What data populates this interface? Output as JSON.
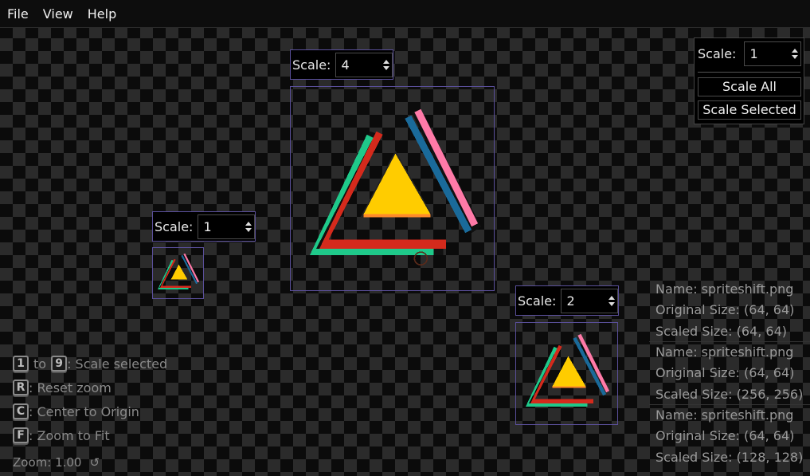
{
  "menu": {
    "items": [
      "File",
      "View",
      "Help"
    ]
  },
  "sprites": [
    {
      "scale_label": "Scale:",
      "scale_value": "4"
    },
    {
      "scale_label": "Scale:",
      "scale_value": "1"
    },
    {
      "scale_label": "Scale:",
      "scale_value": "2"
    }
  ],
  "panel": {
    "scale_label": "Scale:",
    "scale_value": "1",
    "scale_all": "Scale All",
    "scale_selected": "Scale Selected"
  },
  "info": [
    {
      "name": "Name: spriteshift.png",
      "original": "Original Size: (64, 64)",
      "scaled": "Scaled Size: (64, 64)"
    },
    {
      "name": "Name: spriteshift.png",
      "original": "Original Size: (64, 64)",
      "scaled": "Scaled Size: (256, 256)"
    },
    {
      "name": "Name: spriteshift.png",
      "original": "Original Size: (64, 64)",
      "scaled": "Scaled Size: (128, 128)"
    }
  ],
  "help": {
    "key1": "1",
    "to": "to",
    "key9": "9",
    "scale_selected": ": Scale selected",
    "keyR": "R",
    "reset_zoom": ": Reset zoom",
    "keyC": "C",
    "center": ": Center to Origin",
    "keyF": "F",
    "fit": ": Zoom to Fit"
  },
  "zoom": {
    "text": "Zoom: 1.00",
    "icon": "reset-icon"
  },
  "colors": {
    "accent_border": "#5a4f9a",
    "triangle_yellow": "#ffcc00",
    "triangle_red": "#d42a1c",
    "triangle_green": "#1fc98a",
    "triangle_pink": "#ff7aa8",
    "triangle_blue": "#1a6a9a"
  }
}
